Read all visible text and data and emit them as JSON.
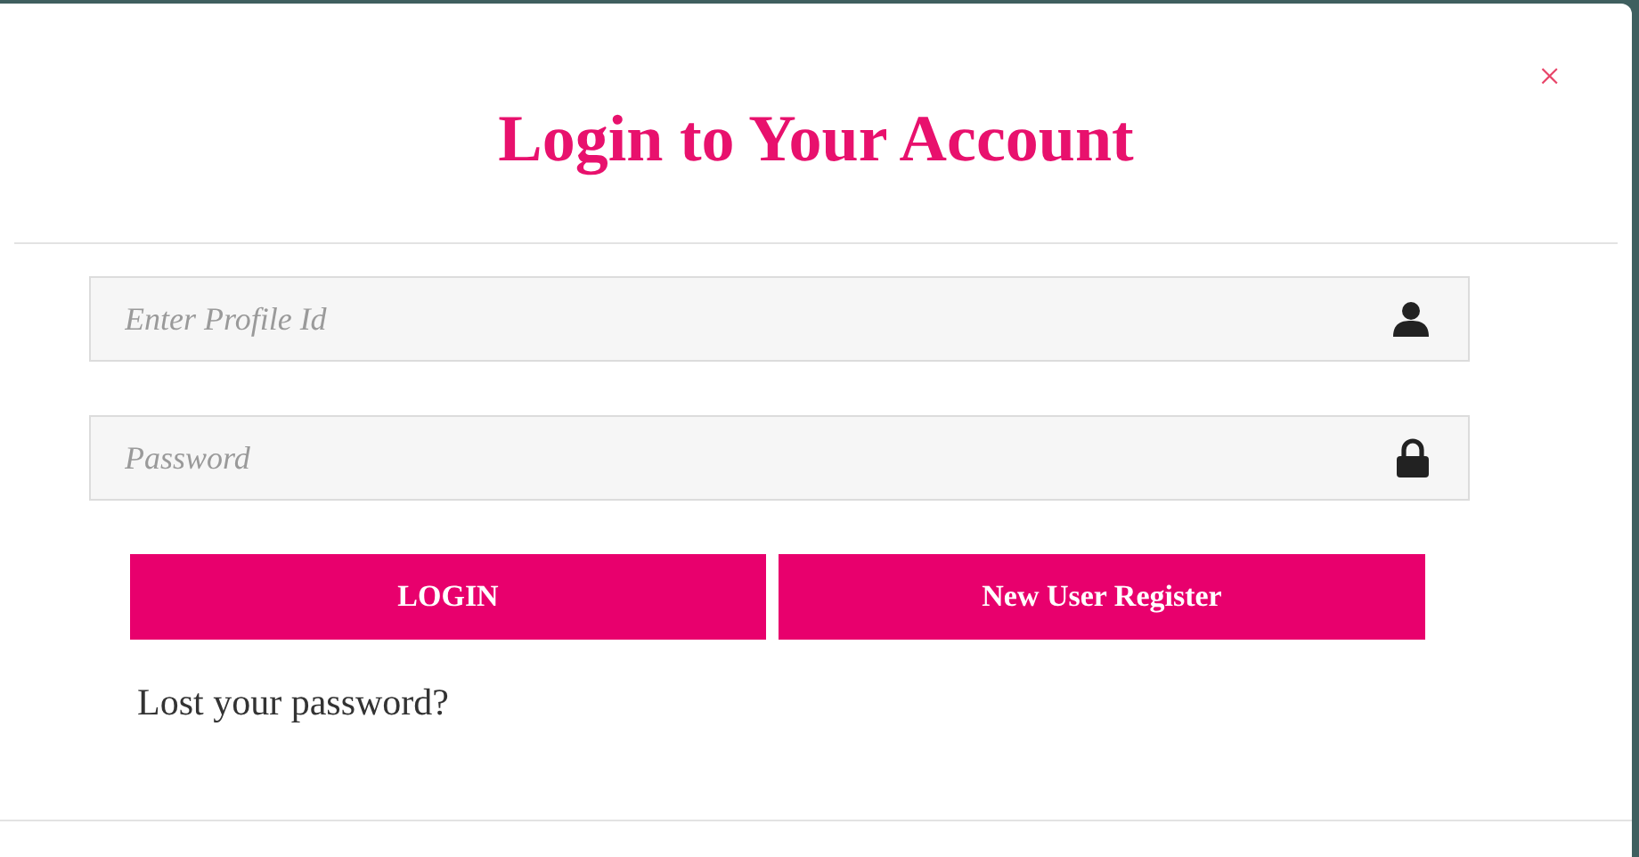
{
  "dialog": {
    "close": "×",
    "title": "Login to Your Account"
  },
  "fields": [
    {
      "kind": "user",
      "placeholder": "Enter Profile Id"
    },
    {
      "kind": "lock",
      "placeholder": "Password"
    }
  ],
  "buttons": [
    "LOGIN",
    "New User Register"
  ],
  "link": "Lost your password?"
}
